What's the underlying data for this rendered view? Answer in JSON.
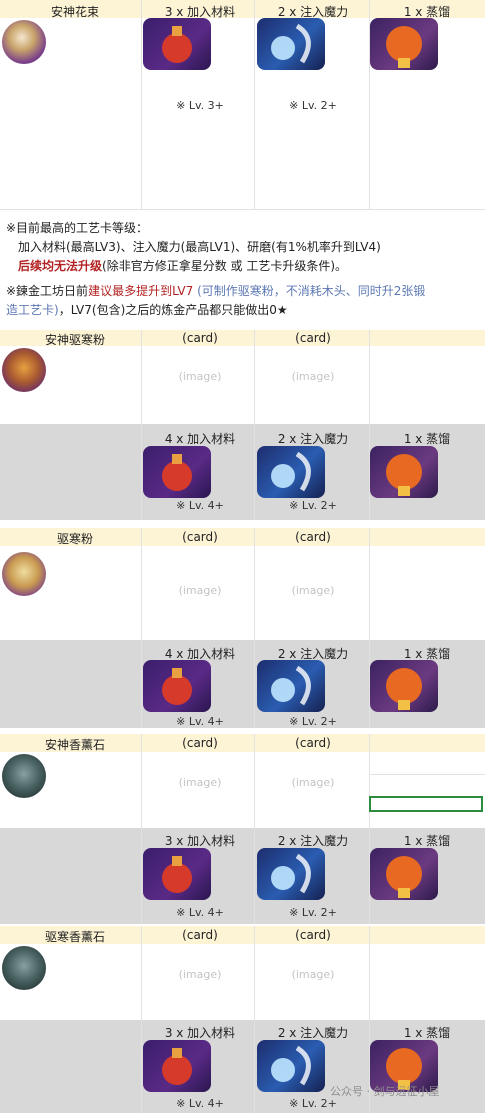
{
  "top_row": {
    "name": "安神花束",
    "steps": [
      "3 x 加入材料",
      "2 x 注入魔力",
      "1 x 蒸馏"
    ],
    "levels": [
      "※ Lv. 3+",
      "※ Lv. 2+"
    ]
  },
  "notes": {
    "line1": "※目前最高的工艺卡等级：",
    "line2": "加入材料(最高LV3)、注入魔力(最高LV1)、研磨(有1%机率升到LV4)",
    "line3_red": "后续均无法升级",
    "line3_rest": "(除非官方修正拿星分数 或 工艺卡升级条件)。",
    "line4_prefix": "※鍊金工坊日前",
    "line4_red": "建议最多提升到LV7",
    "line4_blue": " (可制作驱寒粉，不消耗木头、同时升2张锻",
    "line5_blue": "造工艺卡)",
    "line5_rest": "，LV7(包含)之后的炼金产品都只能做出0★"
  },
  "sections": [
    {
      "name": "安神驱寒粉",
      "card_labels": [
        "(card)",
        "(card)"
      ],
      "image_labels": [
        "(image)",
        "(image)"
      ],
      "steps": [
        "4 x 加入材料",
        "2 x 注入魔力",
        "1 x 蒸馏"
      ],
      "levels": [
        "※ Lv. 4+",
        "※ Lv. 2+"
      ]
    },
    {
      "name": "驱寒粉",
      "card_labels": [
        "(card)",
        "(card)"
      ],
      "image_labels": [
        "(image)",
        "(image)"
      ],
      "steps": [
        "4 x 加入材料",
        "2 x 注入魔力",
        "1 x 蒸馏"
      ],
      "levels": [
        "※ Lv. 4+",
        "※ Lv. 2+"
      ]
    },
    {
      "name": "安神香薰石",
      "card_labels": [
        "(card)",
        "(card)"
      ],
      "image_labels": [
        "(image)",
        "(image)"
      ],
      "steps": [
        "3 x 加入材料",
        "2 x 注入魔力",
        "1 x 蒸馏"
      ],
      "levels": [
        "※ Lv. 4+",
        "※ Lv. 2+"
      ]
    },
    {
      "name": "驱寒香薰石",
      "card_labels": [
        "(card)",
        "(card)"
      ],
      "image_labels": [
        "(image)",
        "(image)"
      ],
      "steps": [
        "3 x 加入材料",
        "2 x 注入魔力",
        "1 x 蒸馏"
      ],
      "levels": [
        "※ Lv. 4+",
        "※ Lv. 2+"
      ]
    }
  ],
  "watermark": "公众号 · 剑与远征小屋",
  "icons": {
    "potion": "red-potion-card-icon",
    "magic": "magic-swirl-card-icon",
    "still": "distill-flask-card-icon"
  }
}
